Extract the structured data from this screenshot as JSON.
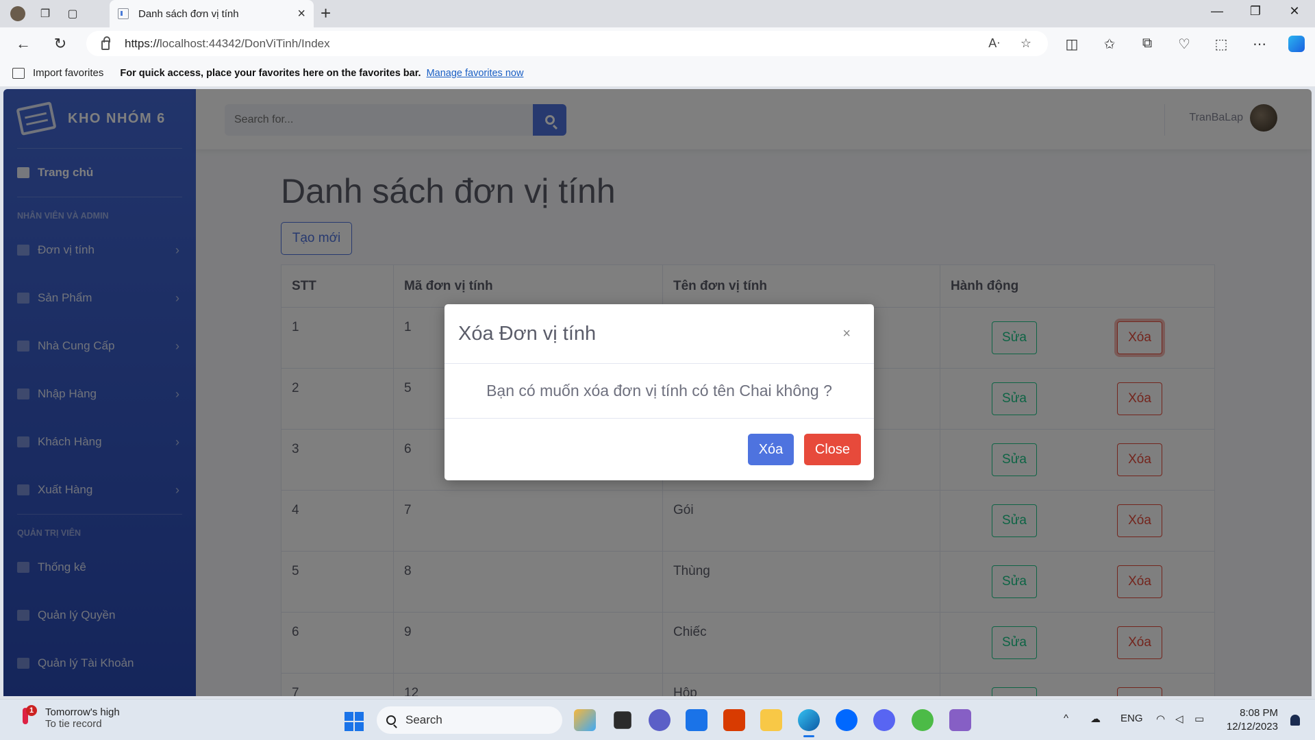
{
  "browser": {
    "tab_title": "Danh sách đơn vị tính",
    "url_prefix": "https://",
    "url_host": "localhost",
    "url_rest": ":44342/DonViTinh/Index",
    "favbar_import": "Import favorites",
    "favbar_message": "For quick access, place your favorites here on the favorites bar.",
    "favbar_link": "Manage favorites now"
  },
  "sidebar": {
    "brand": "KHO NHÓM 6",
    "home": "Trang chủ",
    "section1": "NHÂN VIÊN VÀ ADMIN",
    "items": [
      {
        "label": "Đơn vị tính"
      },
      {
        "label": "Sản Phẩm"
      },
      {
        "label": "Nhà Cung Cấp"
      },
      {
        "label": "Nhập Hàng"
      },
      {
        "label": "Khách Hàng"
      },
      {
        "label": "Xuất Hàng"
      }
    ],
    "section2": "QUẢN TRỊ VIÊN",
    "admin_items": [
      {
        "label": "Thống kê"
      },
      {
        "label": "Quản lý Quyền"
      },
      {
        "label": "Quản lý Tài Khoản"
      }
    ]
  },
  "topbar": {
    "search_placeholder": "Search for...",
    "username": "TranBaLap"
  },
  "main": {
    "title": "Danh sách đơn vị tính",
    "create_label": "Tạo mới",
    "table": {
      "headers": [
        "STT",
        "Mã đơn vị tính",
        "Tên đơn vị tính",
        "Hành động"
      ],
      "rows": [
        {
          "stt": "1",
          "ma": "1",
          "ten": ""
        },
        {
          "stt": "2",
          "ma": "5",
          "ten": ""
        },
        {
          "stt": "3",
          "ma": "6",
          "ten": ""
        },
        {
          "stt": "4",
          "ma": "7",
          "ten": "Gói"
        },
        {
          "stt": "5",
          "ma": "8",
          "ten": "Thùng"
        },
        {
          "stt": "6",
          "ma": "9",
          "ten": "Chiếc"
        },
        {
          "stt": "7",
          "ma": "12",
          "ten": "Hộp"
        }
      ],
      "edit_label": "Sửa",
      "delete_label": "Xóa"
    }
  },
  "modal": {
    "title": "Xóa Đơn vị tính",
    "close_x": "×",
    "body": "Bạn có muốn xóa đơn vị tính có tên Chai không ?",
    "delete_label": "Xóa",
    "close_label": "Close"
  },
  "taskbar": {
    "weather_line1": "Tomorrow's high",
    "weather_line2": "To tie record",
    "weather_badge": "1",
    "search_label": "Search",
    "lang": "ENG",
    "time": "8:08 PM",
    "date": "12/12/2023"
  }
}
